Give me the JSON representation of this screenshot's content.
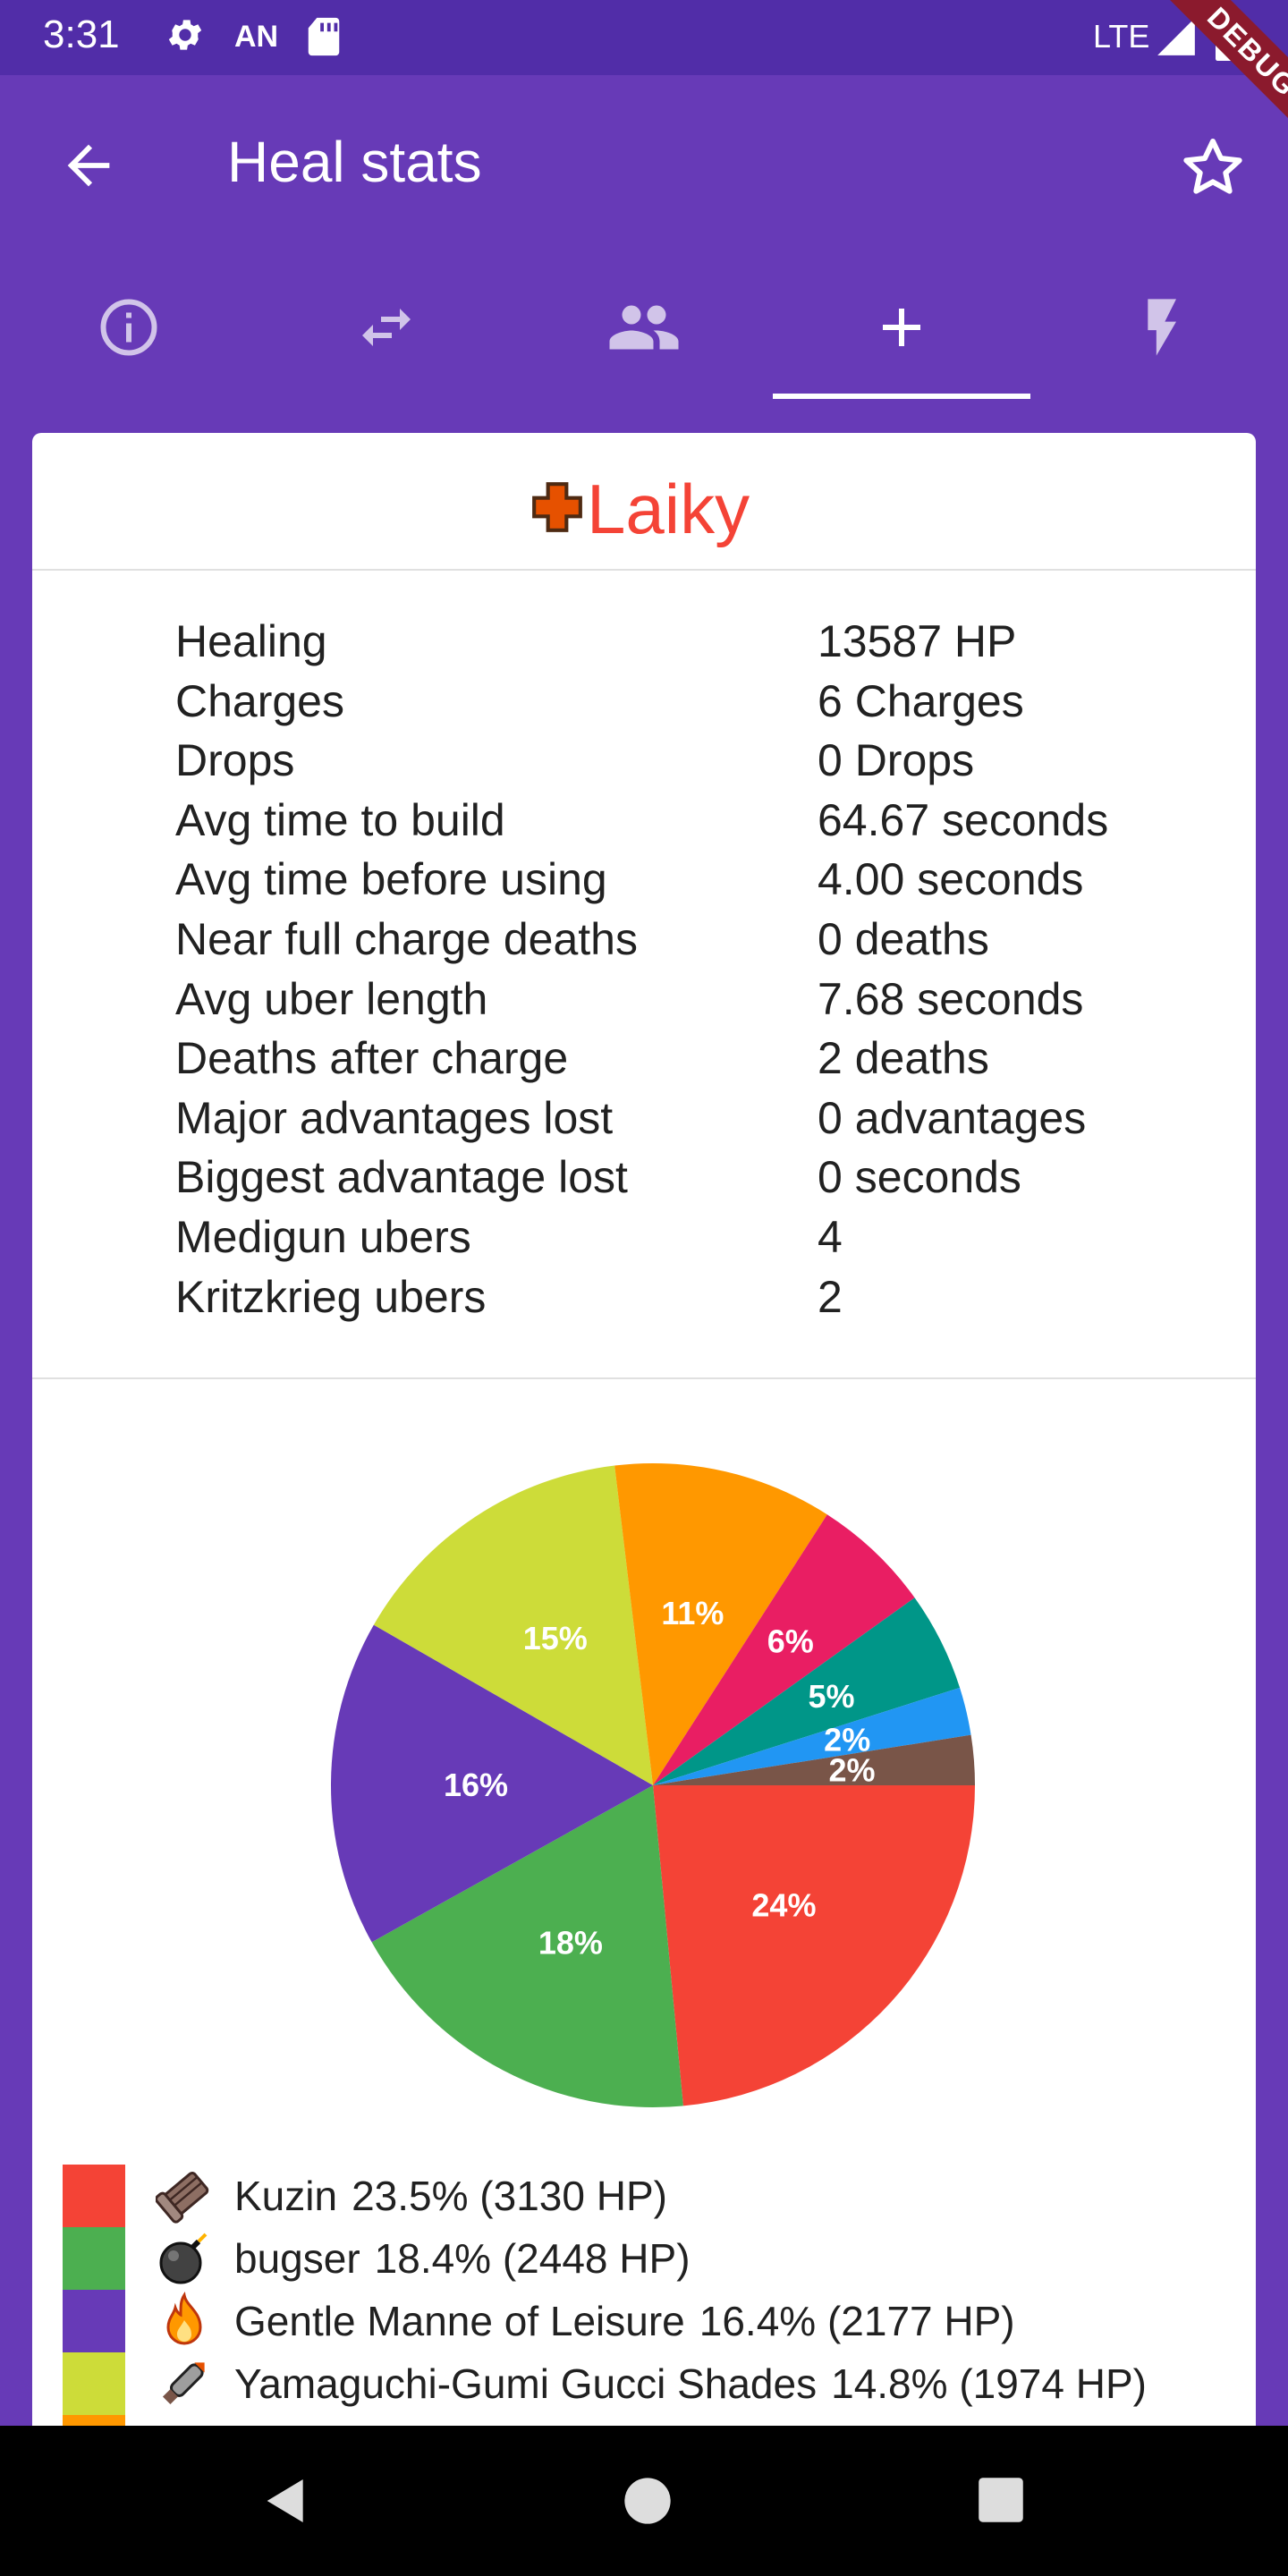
{
  "status_bar": {
    "time": "3:31",
    "carrier": "AN",
    "network": "LTE",
    "debug_banner": "DEBUG"
  },
  "appbar": {
    "title": "Heal stats"
  },
  "tabs": [
    {
      "icon": "info-icon"
    },
    {
      "icon": "swap-icon"
    },
    {
      "icon": "people-icon"
    },
    {
      "icon": "plus-icon",
      "selected": true
    },
    {
      "icon": "lightning-icon"
    }
  ],
  "player": {
    "name": "Laiky",
    "icon": "medic-cross-icon",
    "color": "#f44336"
  },
  "stats": [
    {
      "label": "Healing",
      "value": "13587 HP"
    },
    {
      "label": "Charges",
      "value": "6 Charges"
    },
    {
      "label": "Drops",
      "value": "0 Drops"
    },
    {
      "label": "Avg time to build",
      "value": "64.67 seconds"
    },
    {
      "label": "Avg time before using",
      "value": "4.00 seconds"
    },
    {
      "label": "Near full charge deaths",
      "value": "0 deaths"
    },
    {
      "label": "Avg uber length",
      "value": "7.68 seconds"
    },
    {
      "label": "Deaths after charge",
      "value": "2 deaths"
    },
    {
      "label": "Major advantages lost",
      "value": "0 advantages"
    },
    {
      "label": "Biggest advantage lost",
      "value": "0 seconds"
    },
    {
      "label": "Medigun ubers",
      "value": "4"
    },
    {
      "label": "Kritzkrieg ubers",
      "value": "2"
    }
  ],
  "chart_data": {
    "type": "pie",
    "slices": [
      {
        "label": "24%",
        "value": 23.5,
        "color": "#f44336"
      },
      {
        "label": "18%",
        "value": 18.4,
        "color": "#4caf50"
      },
      {
        "label": "16%",
        "value": 16.4,
        "color": "#673ab7"
      },
      {
        "label": "15%",
        "value": 14.8,
        "color": "#cddc39"
      },
      {
        "label": "11%",
        "value": 11.0,
        "color": "#ff9800"
      },
      {
        "label": "6%",
        "value": 6.0,
        "color": "#e91e63"
      },
      {
        "label": "5%",
        "value": 5.0,
        "color": "#009688"
      },
      {
        "label": "2%",
        "value": 2.4,
        "color": "#2196f3"
      },
      {
        "label": "2%",
        "value": 2.5,
        "color": "#795548"
      }
    ]
  },
  "legend": [
    {
      "color": "#f44336",
      "icon": "minigun-icon",
      "name": "Kuzin",
      "pct": "23.5% (3130 HP)"
    },
    {
      "color": "#4caf50",
      "icon": "bomb-icon",
      "name": "bugser",
      "pct": "18.4% (2448 HP)"
    },
    {
      "color": "#673ab7",
      "icon": "fire-icon",
      "name": "Gentle Manne of Leisure",
      "pct": "16.4% (2177 HP)"
    },
    {
      "color": "#cddc39",
      "icon": "rocket-icon",
      "name": "Yamaguchi-Gumi Gucci Shades",
      "pct": "14.8% (1974 HP)"
    }
  ]
}
